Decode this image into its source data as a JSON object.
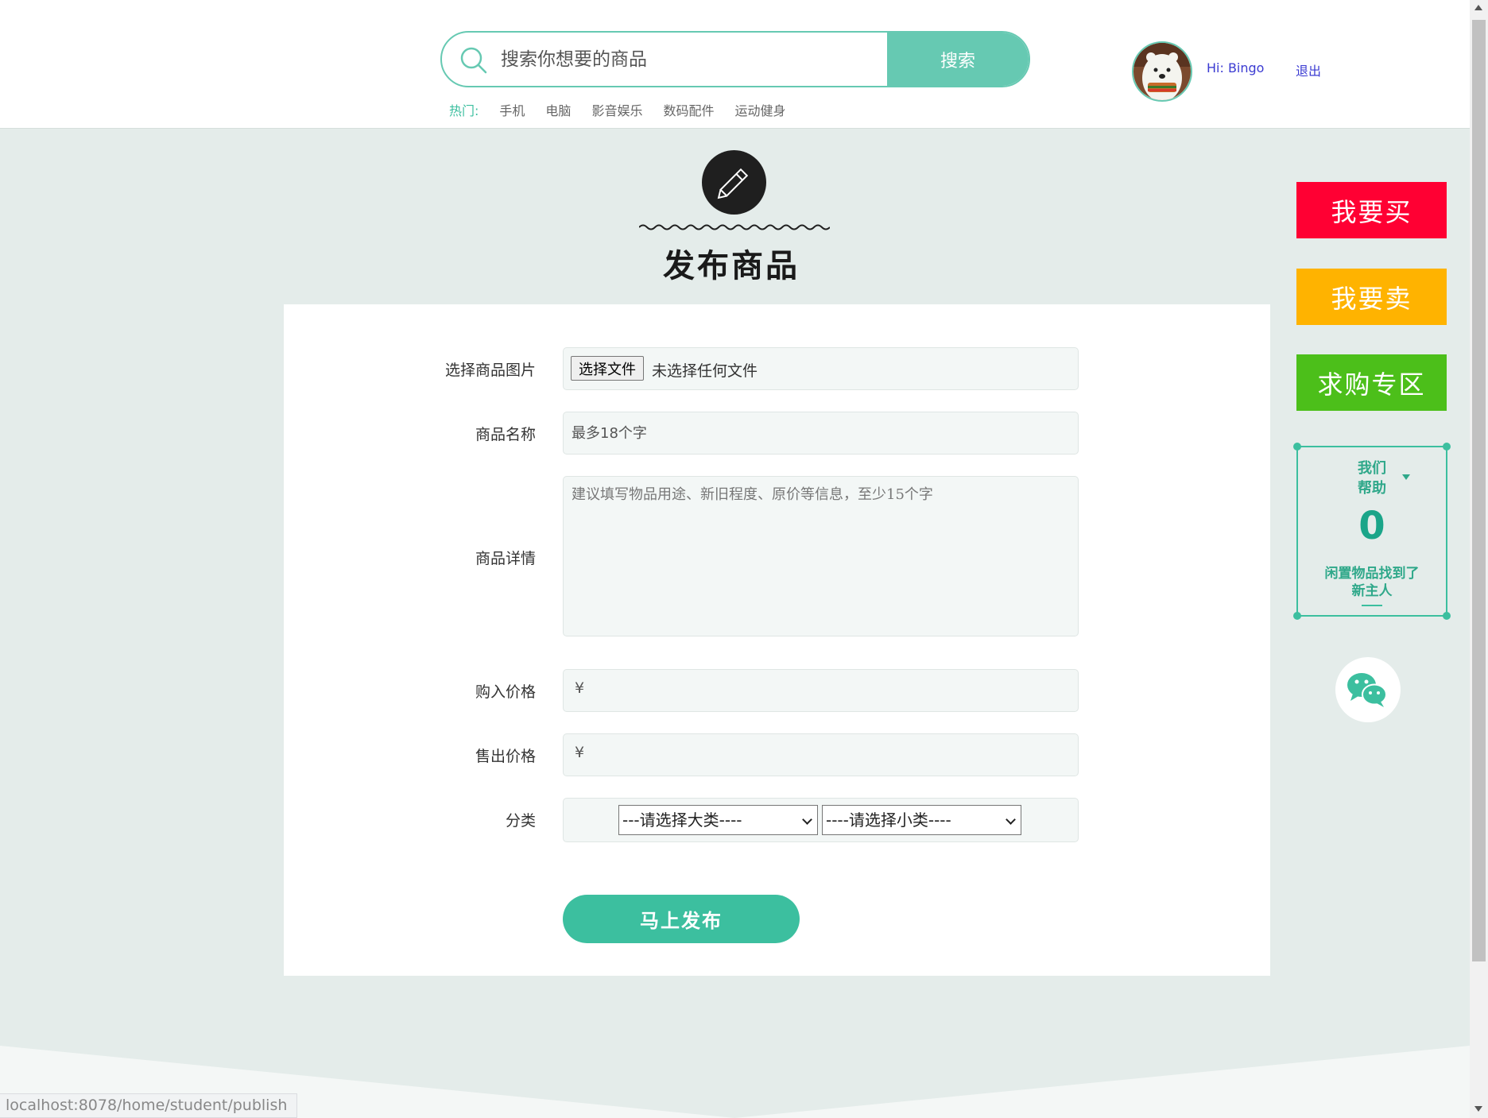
{
  "header": {
    "search": {
      "placeholder": "搜索你想要的商品",
      "button_label": "搜索"
    },
    "hot": {
      "label": "热门:",
      "links": [
        "手机",
        "电脑",
        "影音娱乐",
        "数码配件",
        "运动健身"
      ]
    },
    "user": {
      "greeting": "Hi: Bingo",
      "logout_label": "退出"
    }
  },
  "page": {
    "title": "发布商品"
  },
  "form": {
    "image": {
      "label": "选择商品图片",
      "button_label": "选择文件",
      "status": "未选择任何文件"
    },
    "name": {
      "label": "商品名称",
      "placeholder": "最多18个字"
    },
    "detail": {
      "label": "商品详情",
      "placeholder": "建议填写物品用途、新旧程度、原价等信息，至少15个字"
    },
    "buy_price": {
      "label": "购入价格",
      "currency": "¥"
    },
    "sell_price": {
      "label": "售出价格",
      "currency": "¥"
    },
    "category": {
      "label": "分类",
      "major_selected": "---请选择大类----",
      "minor_selected": "----请选择小类----"
    },
    "submit_label": "马上发布"
  },
  "side_panel": {
    "buy_label": "我要买",
    "sell_label": "我要卖",
    "wanted_label": "求购专区",
    "buy_color": "#ff0033",
    "sell_color": "#ffb300",
    "wanted_color": "#4cbf1a",
    "stats": {
      "heading_line1": "我们",
      "heading_line2": "帮助",
      "count": "0",
      "caption_line1": "闲置物品找到了",
      "caption_line2": "新主人"
    },
    "wechat_icon": "wechat-icon"
  },
  "status_bar": {
    "url": "localhost:8078/home/student/publish"
  },
  "colors": {
    "accent": "#66c9b2",
    "primary_button": "#3cbf9f",
    "page_background": "#e4ecea"
  }
}
